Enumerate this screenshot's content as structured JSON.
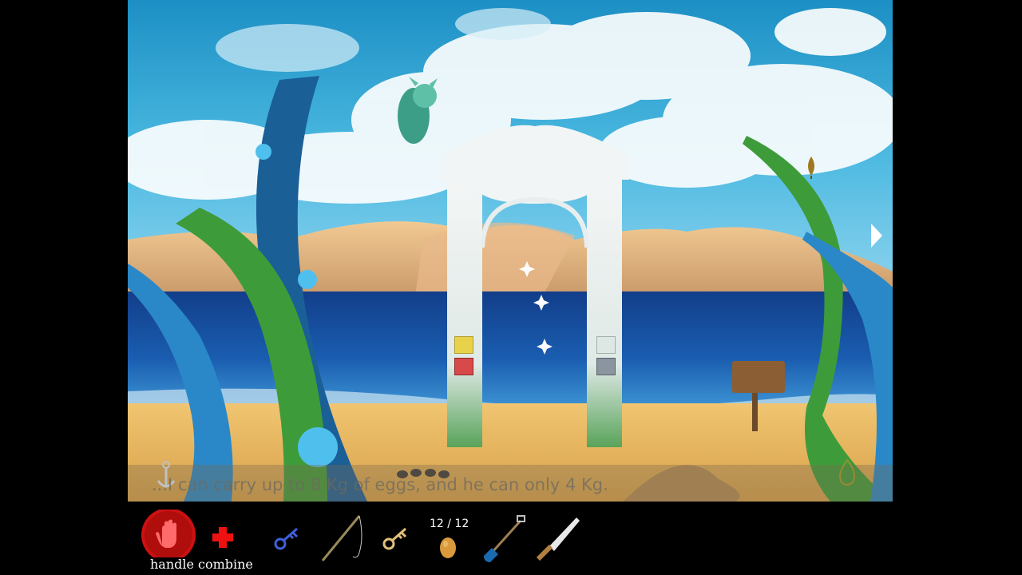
{
  "subtitle": "...I can carry up to 8 Kg of eggs, and he can only 4 Kg.",
  "toolbar": {
    "handle_label": "handle",
    "combine_label": "combine",
    "egg_count": "12 / 12"
  },
  "colors": {
    "sky": "#2aa8d8",
    "sea": "#1a4fa0",
    "sand": "#e8b45a",
    "handle_red": "#cc1111"
  },
  "inventory": [
    "blue-key-icon",
    "fishing-rod-icon",
    "gold-key-icon",
    "egg-icon",
    "shovel-icon",
    "knife-icon"
  ],
  "locks": [
    "yellow",
    "red",
    "white",
    "gray"
  ]
}
